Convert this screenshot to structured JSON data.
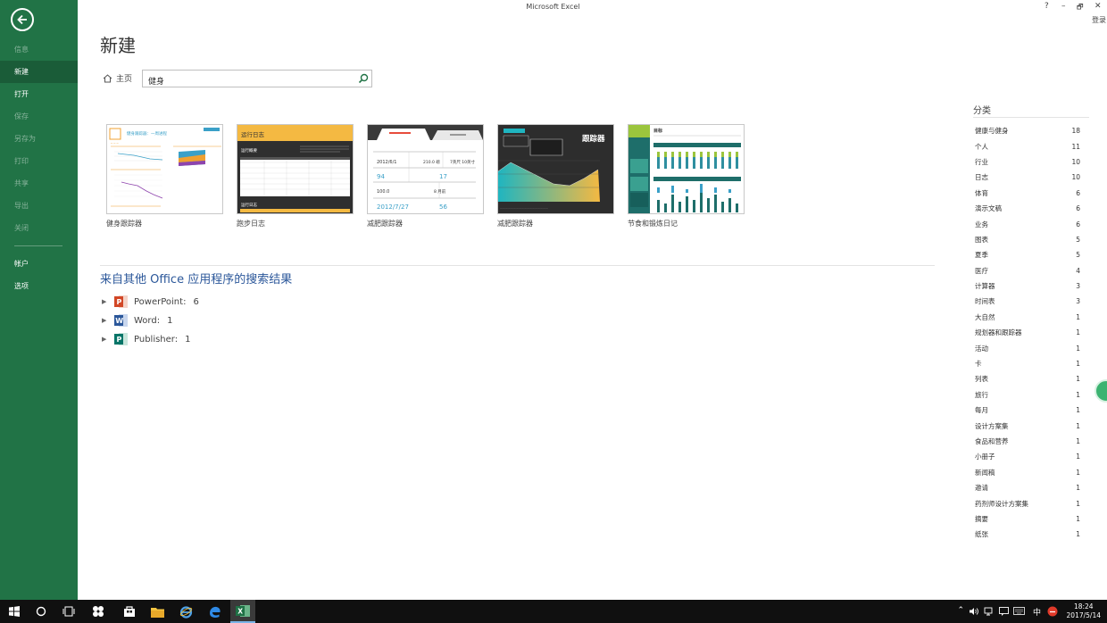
{
  "window": {
    "title": "Microsoft Excel",
    "help": "?",
    "minimize": "–",
    "restore": "🗗",
    "close": "✕",
    "signin": "登录"
  },
  "sidebar": {
    "items": [
      {
        "label": "信息"
      },
      {
        "label": "新建"
      },
      {
        "label": "打开"
      },
      {
        "label": "保存"
      },
      {
        "label": "另存为"
      },
      {
        "label": "打印"
      },
      {
        "label": "共享"
      },
      {
        "label": "导出"
      },
      {
        "label": "关闭"
      },
      {
        "label": "帐户"
      },
      {
        "label": "选项"
      }
    ]
  },
  "main": {
    "title": "新建",
    "home": "主页",
    "search_value": "健身",
    "templates": [
      {
        "label": "健身跟踪器"
      },
      {
        "label": "跑步日志"
      },
      {
        "label": "减肥跟踪器"
      },
      {
        "label": "减肥跟踪器"
      },
      {
        "label": "节食和锻炼日记"
      }
    ],
    "other_heading": "来自其他 Office 应用程序的搜索结果",
    "other_results": [
      {
        "app": "PowerPoint:",
        "count": "6"
      },
      {
        "app": "Word:",
        "count": "1"
      },
      {
        "app": "Publisher:",
        "count": "1"
      }
    ]
  },
  "thumbs": {
    "t1_title": "健身跟踪器：一周进程",
    "t2_title": "运行日志",
    "t2_sub": "运行概要",
    "t2_foot": "运行日志",
    "t3_date1": "2012/6/1",
    "t3_val1": "210.0 磅",
    "t3_val2": "7英尺 10英寸",
    "t3_num1": "94",
    "t3_num2": "17",
    "t3_num3": "100.0",
    "t3_num4": "8 月前",
    "t3_date2": "2012/7/27",
    "t3_num5": "56",
    "t4_title": "跟踪器",
    "t5_title": "目标"
  },
  "categories": {
    "heading": "分类",
    "items": [
      {
        "name": "健康与健身",
        "count": "18"
      },
      {
        "name": "个人",
        "count": "11"
      },
      {
        "name": "行业",
        "count": "10"
      },
      {
        "name": "日志",
        "count": "10"
      },
      {
        "name": "体育",
        "count": "6"
      },
      {
        "name": "演示文稿",
        "count": "6"
      },
      {
        "name": "业务",
        "count": "6"
      },
      {
        "name": "图表",
        "count": "5"
      },
      {
        "name": "夏季",
        "count": "5"
      },
      {
        "name": "医疗",
        "count": "4"
      },
      {
        "name": "计算器",
        "count": "3"
      },
      {
        "name": "时间表",
        "count": "3"
      },
      {
        "name": "大自然",
        "count": "1"
      },
      {
        "name": "规划器和跟踪器",
        "count": "1"
      },
      {
        "name": "活动",
        "count": "1"
      },
      {
        "name": "卡",
        "count": "1"
      },
      {
        "name": "列表",
        "count": "1"
      },
      {
        "name": "旅行",
        "count": "1"
      },
      {
        "name": "每月",
        "count": "1"
      },
      {
        "name": "设计方案集",
        "count": "1"
      },
      {
        "name": "食品和营养",
        "count": "1"
      },
      {
        "name": "小册子",
        "count": "1"
      },
      {
        "name": "新闻稿",
        "count": "1"
      },
      {
        "name": "邀请",
        "count": "1"
      },
      {
        "name": "药剂师设计方案集",
        "count": "1"
      },
      {
        "name": "摘要",
        "count": "1"
      },
      {
        "name": "纸张",
        "count": "1"
      }
    ]
  },
  "taskbar": {
    "ime": "中",
    "time": "18:24",
    "date": "2017/5/14"
  },
  "colors": {
    "accent": "#217346",
    "heading_blue": "#2b579a"
  }
}
